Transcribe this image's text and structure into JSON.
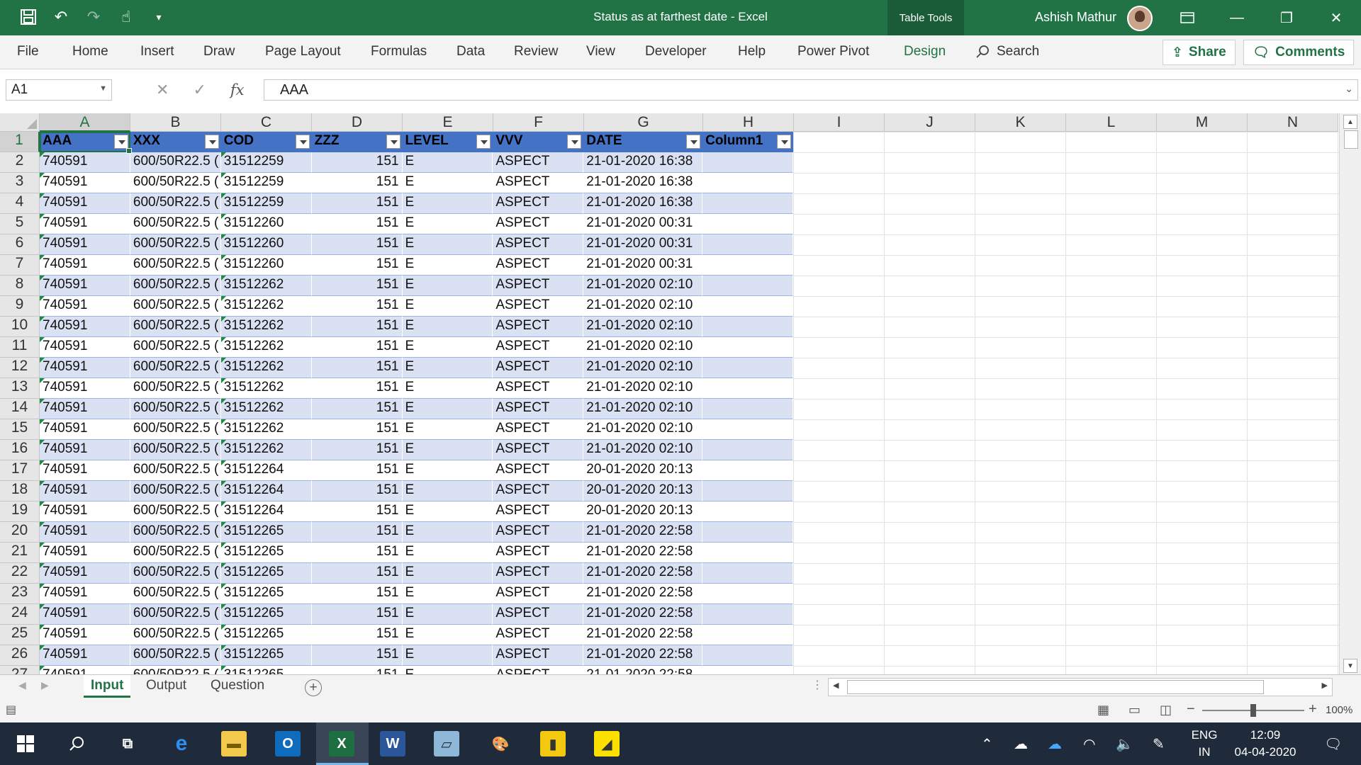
{
  "window": {
    "title": "Status as at farthest date  -  Excel",
    "context_tab": "Table Tools",
    "user": "Ashish Mathur"
  },
  "ribbon": {
    "tabs": [
      "File",
      "Home",
      "Insert",
      "Draw",
      "Page Layout",
      "Formulas",
      "Data",
      "Review",
      "View",
      "Developer",
      "Help",
      "Power Pivot",
      "Design"
    ],
    "search": "Search",
    "share": "Share",
    "comments": "Comments"
  },
  "formula_bar": {
    "name_box": "A1",
    "formula": "AAA",
    "fx": "fx"
  },
  "grid": {
    "columns": [
      "A",
      "B",
      "C",
      "D",
      "E",
      "F",
      "G",
      "H",
      "I",
      "J",
      "K",
      "L",
      "M",
      "N"
    ],
    "headers": [
      "AAA",
      "XXX",
      "COD",
      "ZZZ",
      "LEVEL",
      "VVV",
      "DATE",
      "Column1"
    ],
    "rows": [
      [
        "740591",
        "600/50R22.5 (",
        "31512259",
        "151",
        "E",
        "ASPECT",
        "21-01-2020 16:38",
        ""
      ],
      [
        "740591",
        "600/50R22.5 (",
        "31512259",
        "151",
        "E",
        "ASPECT",
        "21-01-2020 16:38",
        ""
      ],
      [
        "740591",
        "600/50R22.5 (",
        "31512259",
        "151",
        "E",
        "ASPECT",
        "21-01-2020 16:38",
        ""
      ],
      [
        "740591",
        "600/50R22.5 (",
        "31512260",
        "151",
        "E",
        "ASPECT",
        "21-01-2020 00:31",
        ""
      ],
      [
        "740591",
        "600/50R22.5 (",
        "31512260",
        "151",
        "E",
        "ASPECT",
        "21-01-2020 00:31",
        ""
      ],
      [
        "740591",
        "600/50R22.5 (",
        "31512260",
        "151",
        "E",
        "ASPECT",
        "21-01-2020 00:31",
        ""
      ],
      [
        "740591",
        "600/50R22.5 (",
        "31512262",
        "151",
        "E",
        "ASPECT",
        "21-01-2020 02:10",
        ""
      ],
      [
        "740591",
        "600/50R22.5 (",
        "31512262",
        "151",
        "E",
        "ASPECT",
        "21-01-2020 02:10",
        ""
      ],
      [
        "740591",
        "600/50R22.5 (",
        "31512262",
        "151",
        "E",
        "ASPECT",
        "21-01-2020 02:10",
        ""
      ],
      [
        "740591",
        "600/50R22.5 (",
        "31512262",
        "151",
        "E",
        "ASPECT",
        "21-01-2020 02:10",
        ""
      ],
      [
        "740591",
        "600/50R22.5 (",
        "31512262",
        "151",
        "E",
        "ASPECT",
        "21-01-2020 02:10",
        ""
      ],
      [
        "740591",
        "600/50R22.5 (",
        "31512262",
        "151",
        "E",
        "ASPECT",
        "21-01-2020 02:10",
        ""
      ],
      [
        "740591",
        "600/50R22.5 (",
        "31512262",
        "151",
        "E",
        "ASPECT",
        "21-01-2020 02:10",
        ""
      ],
      [
        "740591",
        "600/50R22.5 (",
        "31512262",
        "151",
        "E",
        "ASPECT",
        "21-01-2020 02:10",
        ""
      ],
      [
        "740591",
        "600/50R22.5 (",
        "31512262",
        "151",
        "E",
        "ASPECT",
        "21-01-2020 02:10",
        ""
      ],
      [
        "740591",
        "600/50R22.5 (",
        "31512264",
        "151",
        "E",
        "ASPECT",
        "20-01-2020 20:13",
        ""
      ],
      [
        "740591",
        "600/50R22.5 (",
        "31512264",
        "151",
        "E",
        "ASPECT",
        "20-01-2020 20:13",
        ""
      ],
      [
        "740591",
        "600/50R22.5 (",
        "31512264",
        "151",
        "E",
        "ASPECT",
        "20-01-2020 20:13",
        ""
      ],
      [
        "740591",
        "600/50R22.5 (",
        "31512265",
        "151",
        "E",
        "ASPECT",
        "21-01-2020 22:58",
        ""
      ],
      [
        "740591",
        "600/50R22.5 (",
        "31512265",
        "151",
        "E",
        "ASPECT",
        "21-01-2020 22:58",
        ""
      ],
      [
        "740591",
        "600/50R22.5 (",
        "31512265",
        "151",
        "E",
        "ASPECT",
        "21-01-2020 22:58",
        ""
      ],
      [
        "740591",
        "600/50R22.5 (",
        "31512265",
        "151",
        "E",
        "ASPECT",
        "21-01-2020 22:58",
        ""
      ],
      [
        "740591",
        "600/50R22.5 (",
        "31512265",
        "151",
        "E",
        "ASPECT",
        "21-01-2020 22:58",
        ""
      ],
      [
        "740591",
        "600/50R22.5 (",
        "31512265",
        "151",
        "E",
        "ASPECT",
        "21-01-2020 22:58",
        ""
      ],
      [
        "740591",
        "600/50R22.5 (",
        "31512265",
        "151",
        "E",
        "ASPECT",
        "21-01-2020 22:58",
        ""
      ]
    ]
  },
  "sheets": {
    "tabs": [
      "Input",
      "Output",
      "Question"
    ],
    "active": "Input"
  },
  "status": {
    "zoom": "100%"
  },
  "taskbar": {
    "lang_top": "ENG",
    "lang_bottom": "IN",
    "time": "12:09",
    "date": "04-04-2020"
  },
  "colors": {
    "excel_green": "#217346",
    "table_header": "#4472c4",
    "table_band": "#d9e1f2"
  }
}
